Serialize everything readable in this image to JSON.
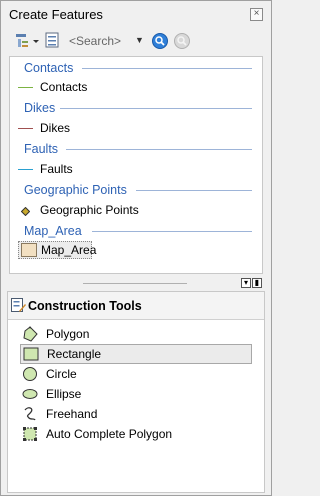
{
  "window": {
    "title": "Create Features",
    "close_glyph": "×"
  },
  "toolbar": {
    "search_placeholder": "<Search>",
    "icons": [
      "organize-templates-icon",
      "template-view-icon",
      "search-icon",
      "clear-search-icon"
    ]
  },
  "templates": {
    "groups": [
      {
        "header": "Contacts",
        "item": "Contacts",
        "symbol": "line",
        "color": "#7cb342"
      },
      {
        "header": "Dikes",
        "item": "Dikes",
        "symbol": "line",
        "color": "#a05050"
      },
      {
        "header": "Faults",
        "item": "Faults",
        "symbol": "line",
        "color": "#2aa0d0"
      },
      {
        "header": "Geographic Points",
        "item": "Geographic Points",
        "symbol": "point",
        "color": "#8a7a20"
      },
      {
        "header": "Map_Area",
        "item": "Map_Area",
        "symbol": "polygon",
        "color": "#f2e0c2"
      }
    ],
    "header_color": "#2e62b4"
  },
  "construction_tools": {
    "title": "Construction Tools",
    "tools": [
      {
        "label": "Polygon",
        "icon": "polygon-icon",
        "selected": false
      },
      {
        "label": "Rectangle",
        "icon": "rectangle-icon",
        "selected": true
      },
      {
        "label": "Circle",
        "icon": "circle-icon",
        "selected": false
      },
      {
        "label": "Ellipse",
        "icon": "ellipse-icon",
        "selected": false
      },
      {
        "label": "Freehand",
        "icon": "freehand-icon",
        "selected": false
      },
      {
        "label": "Auto Complete Polygon",
        "icon": "auto-complete-polygon-icon",
        "selected": false
      }
    ]
  }
}
